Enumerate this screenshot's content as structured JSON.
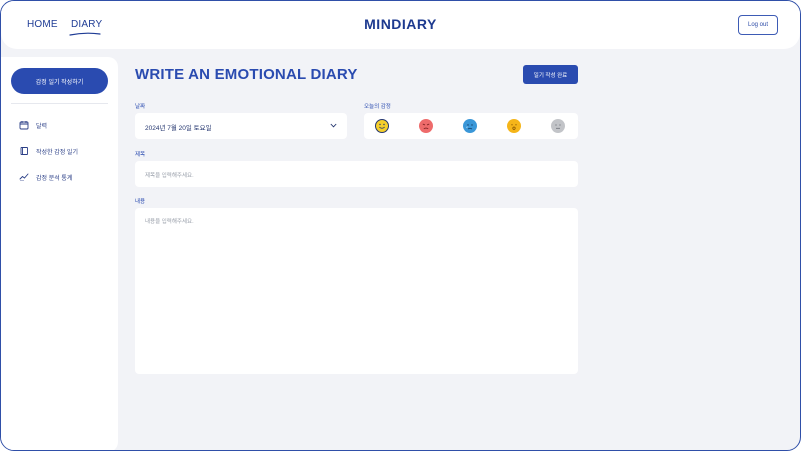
{
  "header": {
    "nav_home": "HOME",
    "nav_diary": "DIARY",
    "logo": "MINDIARY",
    "logout_label": "Log out"
  },
  "sidebar": {
    "write_button": "감정 일기 작성하기",
    "items": [
      {
        "label": "달력",
        "icon": "calendar-icon"
      },
      {
        "label": "작성한 감정 일기",
        "icon": "book-icon"
      },
      {
        "label": "감정 분석 통계",
        "icon": "chart-icon"
      }
    ]
  },
  "main": {
    "title": "WRITE AN EMOTIONAL DIARY",
    "complete_button": "일기 작성 완료",
    "date_label": "날짜",
    "date_value": "2024년 7월 20일 토요일",
    "emotion_label": "오늘의 감정",
    "emotions": [
      {
        "name": "happy",
        "color": "#f5cf2c",
        "selected": true
      },
      {
        "name": "angry",
        "color": "#ee6b6b",
        "selected": false
      },
      {
        "name": "sad",
        "color": "#3a97d8",
        "selected": false
      },
      {
        "name": "surprised",
        "color": "#f5b519",
        "selected": false
      },
      {
        "name": "neutral",
        "color": "#c2c4c8",
        "selected": false
      }
    ],
    "subject_label": "제목",
    "subject_placeholder": "제목을 입력해주세요.",
    "content_label": "내용",
    "content_placeholder": "내용을 입력해주세요."
  },
  "colors": {
    "accent": "#2a4bb0",
    "background": "#f2f3f7"
  }
}
